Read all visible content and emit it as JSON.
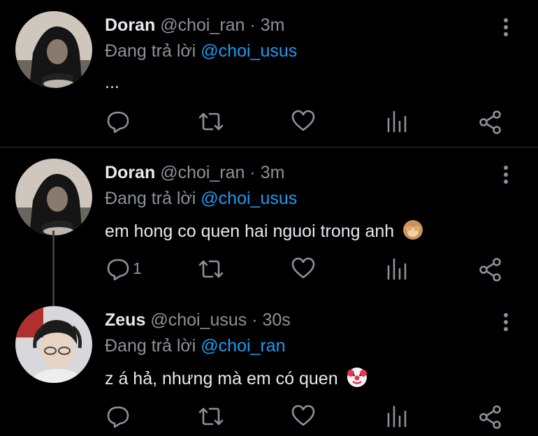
{
  "tweets": [
    {
      "name": "Doran",
      "handle": "@choi_ran",
      "time": "· 3m",
      "reply_prefix": "Đang trả lời",
      "reply_to": "@choi_usus",
      "text": "...",
      "reply_count": ""
    },
    {
      "name": "Doran",
      "handle": "@choi_ran",
      "time": "· 3m",
      "reply_prefix": "Đang trả lời",
      "reply_to": "@choi_usus",
      "text": "em hong co quen hai nguoi trong anh",
      "emoji": "see-no-evil-monkey-emoji",
      "reply_count": "1"
    },
    {
      "name": "Zeus",
      "handle": "@choi_usus",
      "time": "· 30s",
      "reply_prefix": "Đang trả lời",
      "reply_to": "@choi_ran",
      "text": "z á hả, nhưng mà em có quen",
      "emoji": "clown-face-emoji",
      "reply_count": ""
    }
  ],
  "icons": [
    "reply-icon",
    "retweet-icon",
    "like-icon",
    "analytics-icon",
    "share-icon",
    "more-options-icon"
  ],
  "colors": {
    "background": "#000000",
    "text": "#e7e9ea",
    "muted": "#8b9299",
    "mention": "#1d9bf0"
  }
}
